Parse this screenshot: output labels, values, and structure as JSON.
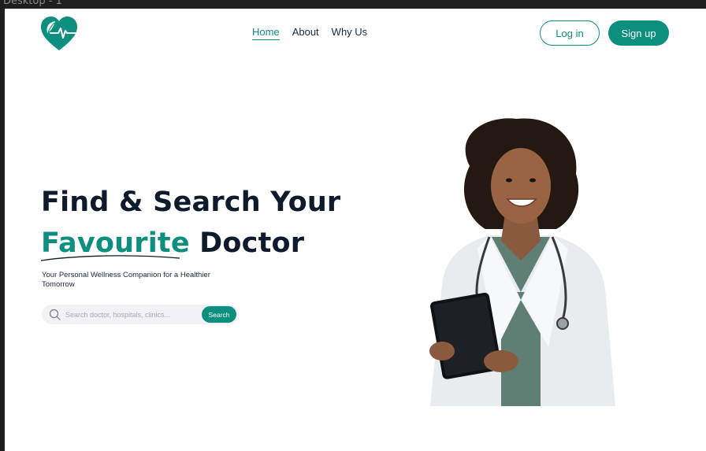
{
  "window": {
    "frame_label": "Desktop - 1"
  },
  "header": {
    "logo_icon": "heart-pulse-leaf-icon",
    "nav": [
      {
        "label": "Home",
        "active": true
      },
      {
        "label": "About",
        "active": false
      },
      {
        "label": "Why Us",
        "active": false
      }
    ],
    "login_label": "Log in",
    "signup_label": "Sign up"
  },
  "hero": {
    "headline_line1": "Find & Search Your",
    "headline_accent": "Favourite",
    "headline_rest": " Doctor",
    "subtitle": "Your Personal Wellness Companion for a Healthier Tomorrow",
    "search": {
      "placeholder": "Search doctor, hospitals, clinics...",
      "button_label": "Search",
      "icon": "search-icon"
    },
    "image": "doctor-with-tablet-photo"
  },
  "colors": {
    "accent": "#0c8f7f",
    "heading": "#0e1b2c",
    "frame_background": "#1e1e1e"
  }
}
